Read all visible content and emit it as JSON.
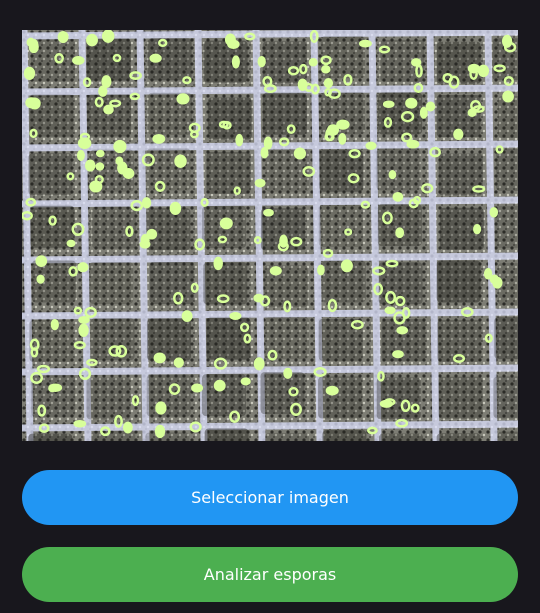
{
  "image": {
    "description_icon": "microscope-spore-image",
    "marker_color": "#d8ff9a"
  },
  "buttons": {
    "select_label": "Seleccionar imagen",
    "select_color": "#2196f3",
    "analyze_label": "Analizar esporas",
    "analyze_color": "#4caf50"
  }
}
